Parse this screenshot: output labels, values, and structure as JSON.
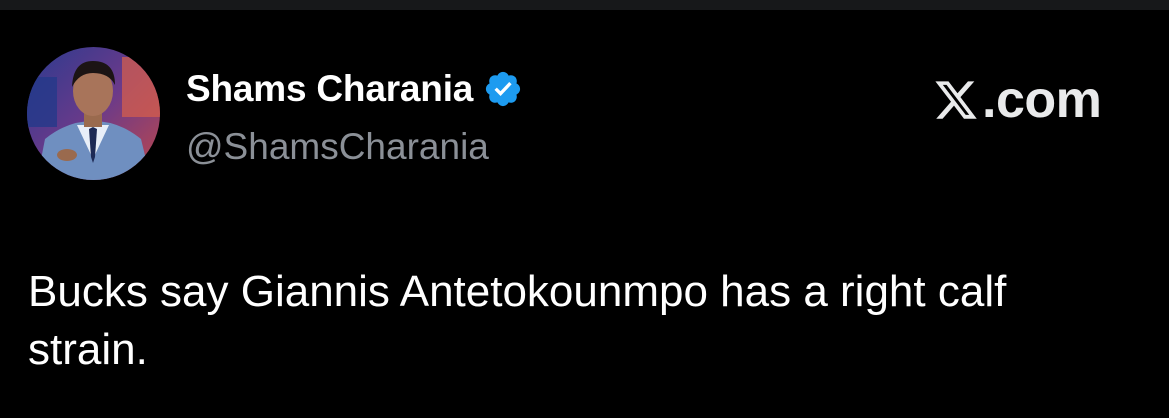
{
  "tweet": {
    "author": {
      "name": "Shams Charania",
      "handle": "@ShamsCharania",
      "verified": true,
      "verified_color": "#1d9bf0"
    },
    "brand": {
      "icon": "x-logo-icon",
      "text": ".com"
    },
    "text": "Bucks say Giannis Antetokounmpo has a right calf strain."
  },
  "colors": {
    "background": "#000000",
    "name": "#ffffff",
    "handle": "#8b9097",
    "body_text": "#ffffff"
  }
}
